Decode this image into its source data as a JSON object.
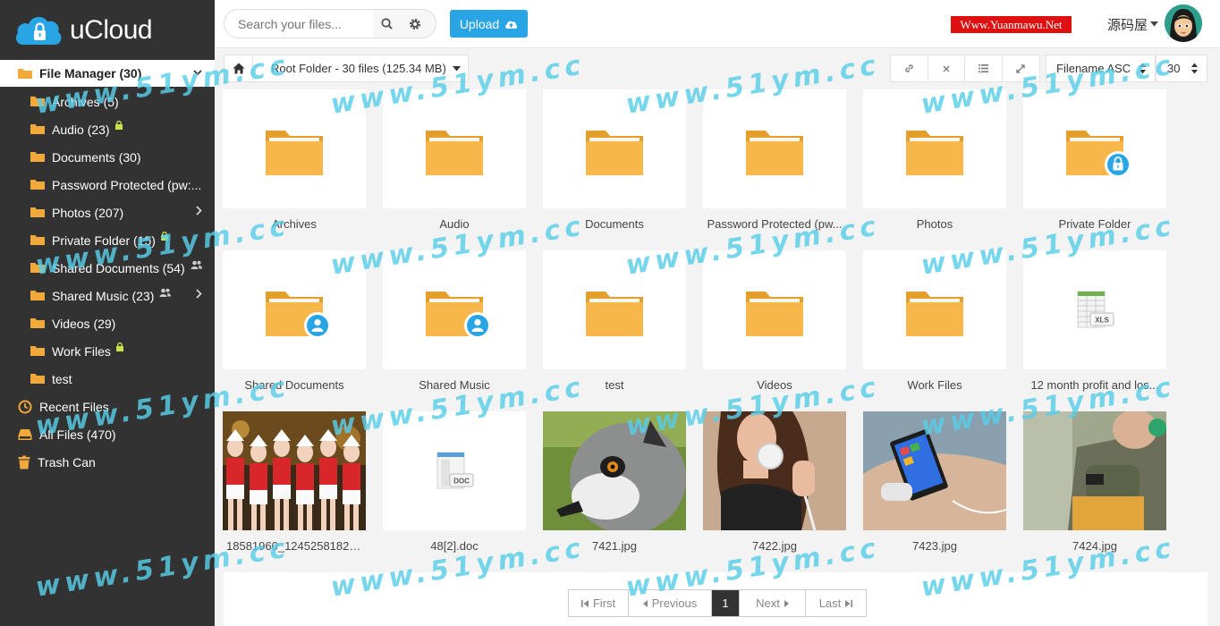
{
  "app": {
    "name": "uCloud"
  },
  "search": {
    "placeholder": "Search your files..."
  },
  "upload": {
    "label": "Upload"
  },
  "site_badge": "Www.Yuanmawu.Net",
  "user": {
    "name": "源码屋"
  },
  "sidebar": {
    "file_manager": "File Manager (30)",
    "folders": [
      {
        "label": "Archives (5)"
      },
      {
        "label": "Audio (23)"
      },
      {
        "label": "Documents (30)"
      },
      {
        "label": "Password Protected (pw:..."
      },
      {
        "label": "Photos (207)"
      },
      {
        "label": "Private Folder (15)"
      },
      {
        "label": "Shared Documents (54)"
      },
      {
        "label": "Shared Music (23)"
      },
      {
        "label": "Videos (29)"
      },
      {
        "label": "Work Files"
      },
      {
        "label": "test"
      }
    ],
    "recent": "Recent Files",
    "all_files": "All Files (470)",
    "trash": "Trash Can"
  },
  "breadcrumb": {
    "text": "Root Folder - 30 files (125.34 MB)"
  },
  "sort": {
    "value": "Filename ASC"
  },
  "per_page": {
    "value": "30"
  },
  "files": [
    {
      "name": "Archives",
      "kind": "folder"
    },
    {
      "name": "Audio",
      "kind": "folder"
    },
    {
      "name": "Documents",
      "kind": "folder"
    },
    {
      "name": "Password Protected (pw...",
      "kind": "folder"
    },
    {
      "name": "Photos",
      "kind": "folder"
    },
    {
      "name": "Private Folder",
      "kind": "folder-lock"
    },
    {
      "name": "Shared Documents",
      "kind": "folder-shared"
    },
    {
      "name": "Shared Music",
      "kind": "folder-shared"
    },
    {
      "name": "test",
      "kind": "folder"
    },
    {
      "name": "Videos",
      "kind": "folder"
    },
    {
      "name": "Work Files",
      "kind": "folder"
    },
    {
      "name": "12 month profit and los...",
      "kind": "xls"
    },
    {
      "name": "18581960_12452581822...",
      "kind": "photo"
    },
    {
      "name": "48[2].doc",
      "kind": "doc"
    },
    {
      "name": "7421.jpg",
      "kind": "photo"
    },
    {
      "name": "7422.jpg",
      "kind": "photo"
    },
    {
      "name": "7423.jpg",
      "kind": "photo"
    },
    {
      "name": "7424.jpg",
      "kind": "photo"
    }
  ],
  "file_type_labels": {
    "xls": "XLS",
    "doc": "DOC"
  },
  "pagination": {
    "first": "First",
    "previous": "Previous",
    "current": "1",
    "next": "Next",
    "last": "Last"
  },
  "watermark": "www.51ym.cc"
}
